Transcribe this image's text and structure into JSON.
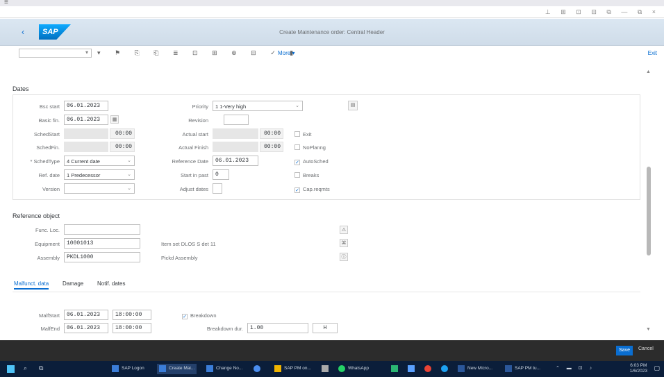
{
  "topbar": {
    "menu_icon": "menu-icon",
    "window_icons": "⊥ ⊞ ⊡ ⊟ ⧉ — ⧉ ×"
  },
  "shell": {
    "back": "‹",
    "logo": "SAP",
    "title": "Create Maintenance order: Central Header"
  },
  "toolbar": {
    "icons": "▾ ⚑ ⎘ ⎗ ≣ ⊡ ⊞ ⊕ ⊟ ✓ ▮",
    "more": "More ▾",
    "exit": "Exit"
  },
  "dates": {
    "title": "Dates",
    "bsc_start_label": "Bsc start",
    "bsc_start": "06.01.2023",
    "basic_fin_label": "Basic fin.",
    "basic_fin": "06.01.2023",
    "sched_start_label": "SchedStart",
    "sched_start_time": "00:00",
    "sched_fin_label": "SchedFin.",
    "sched_fin_time": "00:00",
    "sched_type_label": "* SchedType",
    "sched_type": "4 Current date",
    "ref_date_label": "Ref. date",
    "ref_date_value": "1 Predecessor",
    "version_label": "Version",
    "priority_label": "Priority",
    "priority": "1 1-Very high",
    "revision_label": "Revision",
    "actual_start_label": "Actual start",
    "actual_start_time": "00:00",
    "actual_finish_label": "Actual Finish",
    "actual_finish_time": "00:00",
    "reference_date_label": "Reference Date",
    "reference_date": "06.01.2023",
    "start_in_past_label": "Start in past",
    "start_in_past": "0",
    "adjust_dates_label": "Adjust dates",
    "chk_exit": "Exit",
    "chk_no_planning": "NoPlanng",
    "chk_automatic": "AutoSched",
    "chk_breaks": "Breaks",
    "chk_cap_reqmts": "Cap.reqmts"
  },
  "reference": {
    "title": "Reference object",
    "func_loc_label": "Func. Loc.",
    "equipment_label": "Equipment",
    "equipment": "10001013",
    "equipment_desc": "Item set DLOS S det 11",
    "assembly_label": "Assembly",
    "assembly": "PKDL1000",
    "assembly_desc": "Pickd Assembly"
  },
  "tabs": [
    {
      "label": "Malfunct. data"
    },
    {
      "label": "Damage"
    },
    {
      "label": "Notif. dates"
    }
  ],
  "malfunction": {
    "malf_start_label": "MalfStart",
    "malf_start_date": "06.01.2023",
    "malf_start_time": "18:00:00",
    "malf_end_label": "MalfEnd",
    "malf_end_date": "06.01.2023",
    "malf_end_time": "18:00:00",
    "breakdown_label": "Breakdown",
    "breakdown_dur_label": "Breakdown dur.",
    "breakdown_dur": "1.00",
    "unit_btn": "H"
  },
  "footer": {
    "save": "Save",
    "cancel": "Cancel"
  },
  "taskbar": {
    "items": [
      {
        "label": "SAP Logon"
      },
      {
        "label": "Create Mai..."
      },
      {
        "label": "Change No..."
      },
      {
        "label": ""
      },
      {
        "label": "SAP PM on..."
      },
      {
        "label": ""
      },
      {
        "label": "WhatsApp"
      },
      {
        "label": ""
      },
      {
        "label": ""
      },
      {
        "label": ""
      },
      {
        "label": ""
      },
      {
        "label": "New Micro..."
      },
      {
        "label": "SAP PM tu..."
      }
    ],
    "time": "6:03 PM",
    "date": "1/6/2023"
  }
}
